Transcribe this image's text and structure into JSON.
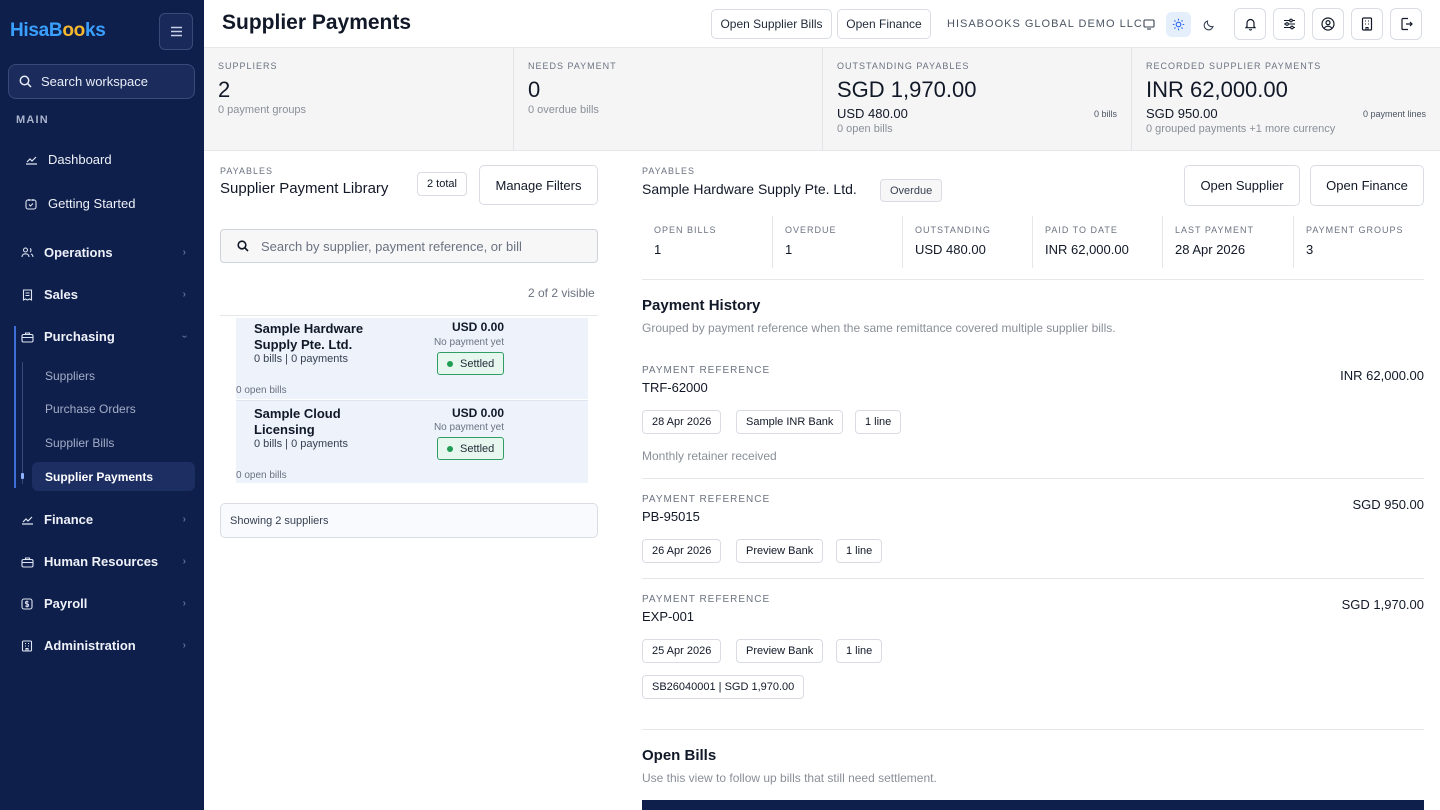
{
  "sidebar": {
    "logo_a": "HisaB",
    "logo_o": "oo",
    "logo_b": "ks",
    "search_label": "Search workspace",
    "section": "MAIN",
    "items": {
      "dashboard": "Dashboard",
      "getting_started": "Getting Started",
      "operations": "Operations",
      "sales": "Sales",
      "purchasing": "Purchasing",
      "finance": "Finance",
      "hr": "Human Resources",
      "payroll": "Payroll",
      "administration": "Administration"
    },
    "purchasing_sub": {
      "suppliers": "Suppliers",
      "purchase_orders": "Purchase Orders",
      "supplier_bills": "Supplier Bills",
      "supplier_payments": "Supplier Payments"
    }
  },
  "header": {
    "title": "Supplier Payments",
    "open_bills": "Open Supplier Bills",
    "open_finance": "Open Finance",
    "company": "HISABOOKS GLOBAL DEMO LLC"
  },
  "stats": {
    "suppliers": {
      "label": "SUPPLIERS",
      "value": "2",
      "sub": "0 payment groups"
    },
    "needs_payment": {
      "label": "NEEDS PAYMENT",
      "value": "0",
      "sub": "0 overdue bills"
    },
    "outstanding": {
      "label": "OUTSTANDING PAYABLES",
      "value": "SGD 1,970.00",
      "secondary": "USD 480.00",
      "sub": "0 open bills",
      "right": "0 bills"
    },
    "recorded": {
      "label": "RECORDED SUPPLIER PAYMENTS",
      "value": "INR 62,000.00",
      "secondary": "SGD 950.00",
      "sub": "0 grouped payments +1 more currency",
      "right": "0 payment lines"
    }
  },
  "library": {
    "kicker": "PAYABLES",
    "title": "Supplier Payment Library",
    "total": "2 total",
    "manage_filters": "Manage Filters",
    "search_placeholder": "Search by supplier, payment reference, or bill",
    "visible": "2 of 2 visible",
    "suppliers": [
      {
        "name": "Sample Hardware Supply Pte. Ltd.",
        "meta": "0 bills | 0 payments",
        "amount": "USD 0.00",
        "status_text": "No payment yet",
        "badge": "Settled",
        "open": "0 open bills"
      },
      {
        "name": "Sample Cloud Licensing",
        "meta": "0 bills | 0 payments",
        "amount": "USD 0.00",
        "status_text": "No payment yet",
        "badge": "Settled",
        "open": "0 open bills"
      }
    ],
    "showing": "Showing 2 suppliers"
  },
  "detail": {
    "kicker": "PAYABLES",
    "title": "Sample Hardware Supply Pte. Ltd.",
    "badge": "Overdue",
    "open_supplier": "Open Supplier",
    "open_finance": "Open Finance",
    "metrics": [
      {
        "label": "OPEN BILLS",
        "value": "1"
      },
      {
        "label": "OVERDUE",
        "value": "1"
      },
      {
        "label": "OUTSTANDING",
        "value": "USD 480.00"
      },
      {
        "label": "PAID TO DATE",
        "value": "INR 62,000.00"
      },
      {
        "label": "LAST PAYMENT",
        "value": "28 Apr 2026"
      },
      {
        "label": "PAYMENT GROUPS",
        "value": "3"
      }
    ],
    "history_title": "Payment History",
    "history_desc": "Grouped by payment reference when the same remittance covered multiple supplier bills.",
    "ref_label": "PAYMENT REFERENCE",
    "payments": [
      {
        "ref": "TRF-62000",
        "amount": "INR 62,000.00",
        "date": "28 Apr 2026",
        "bank": "Sample INR Bank",
        "lines": "1 line",
        "note": "Monthly retainer received"
      },
      {
        "ref": "PB-95015",
        "amount": "SGD 950.00",
        "date": "26 Apr 2026",
        "bank": "Preview Bank",
        "lines": "1 line"
      },
      {
        "ref": "EXP-001",
        "amount": "SGD 1,970.00",
        "date": "25 Apr 2026",
        "bank": "Preview Bank",
        "lines": "1 line",
        "bill": "SB26040001 | SGD 1,970.00"
      }
    ],
    "open_bills_title": "Open Bills",
    "open_bills_desc": "Use this view to follow up bills that still need settlement."
  }
}
